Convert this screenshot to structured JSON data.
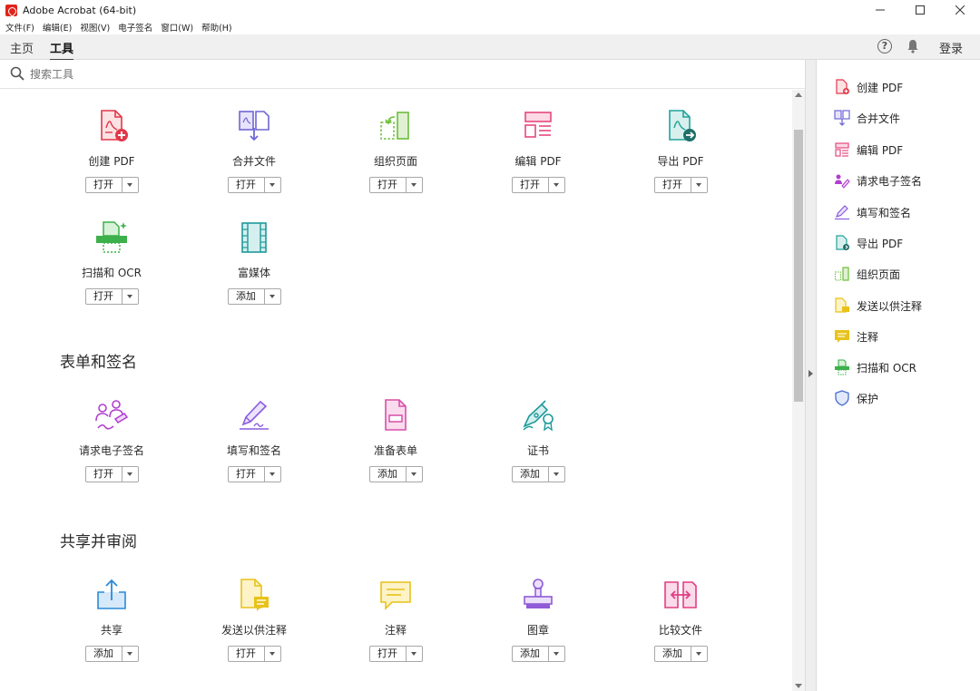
{
  "window": {
    "title": "Adobe Acrobat (64-bit)"
  },
  "menu": [
    "文件(F)",
    "编辑(E)",
    "视图(V)",
    "电子签名",
    "窗口(W)",
    "帮助(H)"
  ],
  "nav": {
    "tabs": [
      "主页",
      "工具"
    ],
    "active": "工具",
    "signin": "登录",
    "help_glyph": "?"
  },
  "search": {
    "placeholder": "搜索工具",
    "value": ""
  },
  "sections": [
    {
      "title": "",
      "tools": [
        {
          "label": "创建 PDF",
          "action": "打开",
          "icon": "create-pdf-icon",
          "color": "#e2374a"
        },
        {
          "label": "合并文件",
          "action": "打开",
          "icon": "combine-files-icon",
          "color": "#6e67d6"
        },
        {
          "label": "组织页面",
          "action": "打开",
          "icon": "organize-pages-icon",
          "color": "#6dbd3b"
        },
        {
          "label": "编辑 PDF",
          "action": "打开",
          "icon": "edit-pdf-icon",
          "color": "#e6487d"
        },
        {
          "label": "导出 PDF",
          "action": "打开",
          "icon": "export-pdf-icon",
          "color": "#22a39a"
        },
        {
          "label": "扫描和 OCR",
          "action": "打开",
          "icon": "scan-ocr-icon",
          "color": "#3cb04a"
        },
        {
          "label": "富媒体",
          "action": "添加",
          "icon": "rich-media-icon",
          "color": "#1e9a9a"
        }
      ]
    },
    {
      "title": "表单和签名",
      "tools": [
        {
          "label": "请求电子签名",
          "action": "打开",
          "icon": "request-esign-icon",
          "color": "#b03fd0"
        },
        {
          "label": "填写和签名",
          "action": "打开",
          "icon": "fill-sign-icon",
          "color": "#8a5ce0"
        },
        {
          "label": "准备表单",
          "action": "添加",
          "icon": "prepare-form-icon",
          "color": "#d84fa8"
        },
        {
          "label": "证书",
          "action": "添加",
          "icon": "certificates-icon",
          "color": "#1e9a9a"
        }
      ]
    },
    {
      "title": "共享并审阅",
      "tools": [
        {
          "label": "共享",
          "action": "添加",
          "icon": "share-icon",
          "color": "#2a8ad8"
        },
        {
          "label": "发送以供注释",
          "action": "打开",
          "icon": "send-for-comments-icon",
          "color": "#e8c21a"
        },
        {
          "label": "注释",
          "action": "打开",
          "icon": "comment-icon",
          "color": "#e8c21a"
        },
        {
          "label": "图章",
          "action": "添加",
          "icon": "stamp-icon",
          "color": "#8f5bd6"
        },
        {
          "label": "比较文件",
          "action": "添加",
          "icon": "compare-files-icon",
          "color": "#e13e83"
        }
      ]
    }
  ],
  "right_panel": [
    {
      "label": "创建 PDF",
      "icon": "create-pdf-icon",
      "color": "#e2374a"
    },
    {
      "label": "合并文件",
      "icon": "combine-files-icon",
      "color": "#6e67d6"
    },
    {
      "label": "编辑 PDF",
      "icon": "edit-pdf-icon",
      "color": "#e6487d"
    },
    {
      "label": "请求电子签名",
      "icon": "request-esign-icon",
      "color": "#b03fd0"
    },
    {
      "label": "填写和签名",
      "icon": "fill-sign-icon",
      "color": "#8a5ce0"
    },
    {
      "label": "导出 PDF",
      "icon": "export-pdf-icon",
      "color": "#22a39a"
    },
    {
      "label": "组织页面",
      "icon": "organize-pages-icon",
      "color": "#6dbd3b"
    },
    {
      "label": "发送以供注释",
      "icon": "send-for-comments-icon",
      "color": "#e8c21a"
    },
    {
      "label": "注释",
      "icon": "comment-icon",
      "color": "#e8c21a"
    },
    {
      "label": "扫描和 OCR",
      "icon": "scan-ocr-icon",
      "color": "#3cb04a"
    },
    {
      "label": "保护",
      "icon": "protect-icon",
      "color": "#4a6fd0"
    }
  ]
}
